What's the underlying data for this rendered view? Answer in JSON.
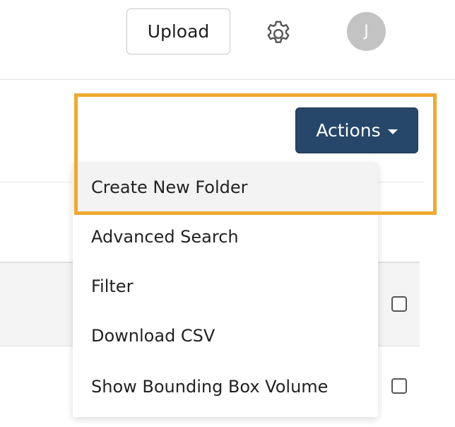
{
  "header": {
    "upload_label": "Upload",
    "settings_icon": "gear-icon",
    "avatar_initial": "J"
  },
  "actions": {
    "label": "Actions",
    "caret_icon": "caret-down-icon",
    "menu": [
      {
        "label": "Create New Folder",
        "hovered": true
      },
      {
        "label": "Advanced Search",
        "hovered": false
      },
      {
        "label": "Filter",
        "hovered": false
      },
      {
        "label": "Download CSV",
        "hovered": false
      },
      {
        "label": "Show Bounding Box Volume",
        "hovered": false
      }
    ]
  },
  "table": {
    "rows": [
      {
        "checked": false
      },
      {
        "checked": false
      }
    ]
  },
  "colors": {
    "actions_button": "#26476a",
    "highlight_border": "#f0a830",
    "avatar_bg": "#c3c3c3",
    "hover_bg": "#f3f3f3"
  }
}
